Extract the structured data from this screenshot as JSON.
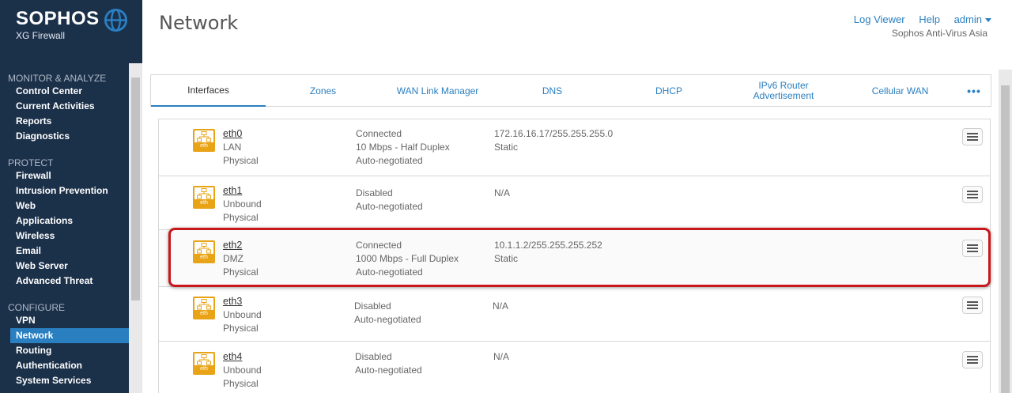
{
  "brand": {
    "name": "SOPHOS",
    "product": "XG Firewall"
  },
  "header": {
    "title": "Network",
    "links": {
      "log_viewer": "Log Viewer",
      "help": "Help",
      "admin": "admin"
    },
    "organization": "Sophos Anti-Virus Asia"
  },
  "sidebar": {
    "sections": [
      {
        "title": "MONITOR & ANALYZE",
        "items": [
          "Control Center",
          "Current Activities",
          "Reports",
          "Diagnostics"
        ]
      },
      {
        "title": "PROTECT",
        "items": [
          "Firewall",
          "Intrusion Prevention",
          "Web",
          "Applications",
          "Wireless",
          "Email",
          "Web Server",
          "Advanced Threat"
        ]
      },
      {
        "title": "CONFIGURE",
        "items": [
          "VPN",
          "Network",
          "Routing",
          "Authentication",
          "System Services"
        ]
      }
    ],
    "active_item": "Network"
  },
  "tabs": [
    "Interfaces",
    "Zones",
    "WAN Link Manager",
    "DNS",
    "DHCP",
    "IPv6 Router Advertisement",
    "Cellular WAN"
  ],
  "active_tab": "Interfaces",
  "icon_label": "eth",
  "interfaces": [
    {
      "name": "eth0",
      "zone": "LAN",
      "type": "Physical",
      "status": [
        "Connected",
        "10 Mbps - Half Duplex",
        "Auto-negotiated"
      ],
      "ip": [
        "172.16.16.17/255.255.255.0",
        "Static"
      ]
    },
    {
      "name": "eth1",
      "zone": "Unbound",
      "type": "Physical",
      "status": [
        "Disabled",
        "Auto-negotiated"
      ],
      "ip": [
        "N/A"
      ]
    },
    {
      "name": "eth2",
      "zone": "DMZ",
      "type": "Physical",
      "status": [
        "Connected",
        "1000 Mbps - Full Duplex",
        "Auto-negotiated"
      ],
      "ip": [
        "10.1.1.2/255.255.255.252",
        "Static"
      ]
    },
    {
      "name": "eth3",
      "zone": "Unbound",
      "type": "Physical",
      "status": [
        "Disabled",
        "Auto-negotiated"
      ],
      "ip": [
        "N/A"
      ]
    },
    {
      "name": "eth4",
      "zone": "Unbound",
      "type": "Physical",
      "status": [
        "Disabled",
        "Auto-negotiated"
      ],
      "ip": [
        "N/A"
      ]
    }
  ],
  "colors": {
    "sidebar_bg": "#1b3049",
    "accent": "#2a7fc1",
    "icon_orange": "#e8a317",
    "highlight_red": "#c8171b"
  }
}
